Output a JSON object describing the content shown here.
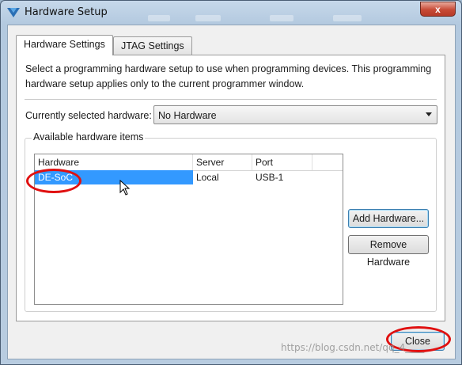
{
  "window": {
    "title": "Hardware Setup",
    "close_glyph": "x"
  },
  "tabs": [
    {
      "label": "Hardware Settings",
      "active": true
    },
    {
      "label": "JTAG Settings",
      "active": false
    }
  ],
  "description": "Select a programming hardware setup to use when programming devices. This programming hardware setup applies only to the current programmer window.",
  "current_hardware": {
    "label": "Currently selected hardware:",
    "value": "No Hardware"
  },
  "available": {
    "legend": "Available hardware items",
    "columns": [
      "Hardware",
      "Server",
      "Port"
    ],
    "rows": [
      {
        "hardware": "DE-SoC",
        "server": "Local",
        "port": "USB-1",
        "selected": true
      }
    ]
  },
  "buttons": {
    "add": "Add Hardware...",
    "remove": "Remove Hardware",
    "close": "Close"
  },
  "watermark": "https://blog.csdn.net/qq_4____",
  "colors": {
    "selection": "#3399ff",
    "highlight_ring": "#e01010"
  },
  "icons": [
    "altera-logo-icon",
    "close-icon",
    "dropdown-arrow-icon",
    "mouse-cursor-icon"
  ]
}
